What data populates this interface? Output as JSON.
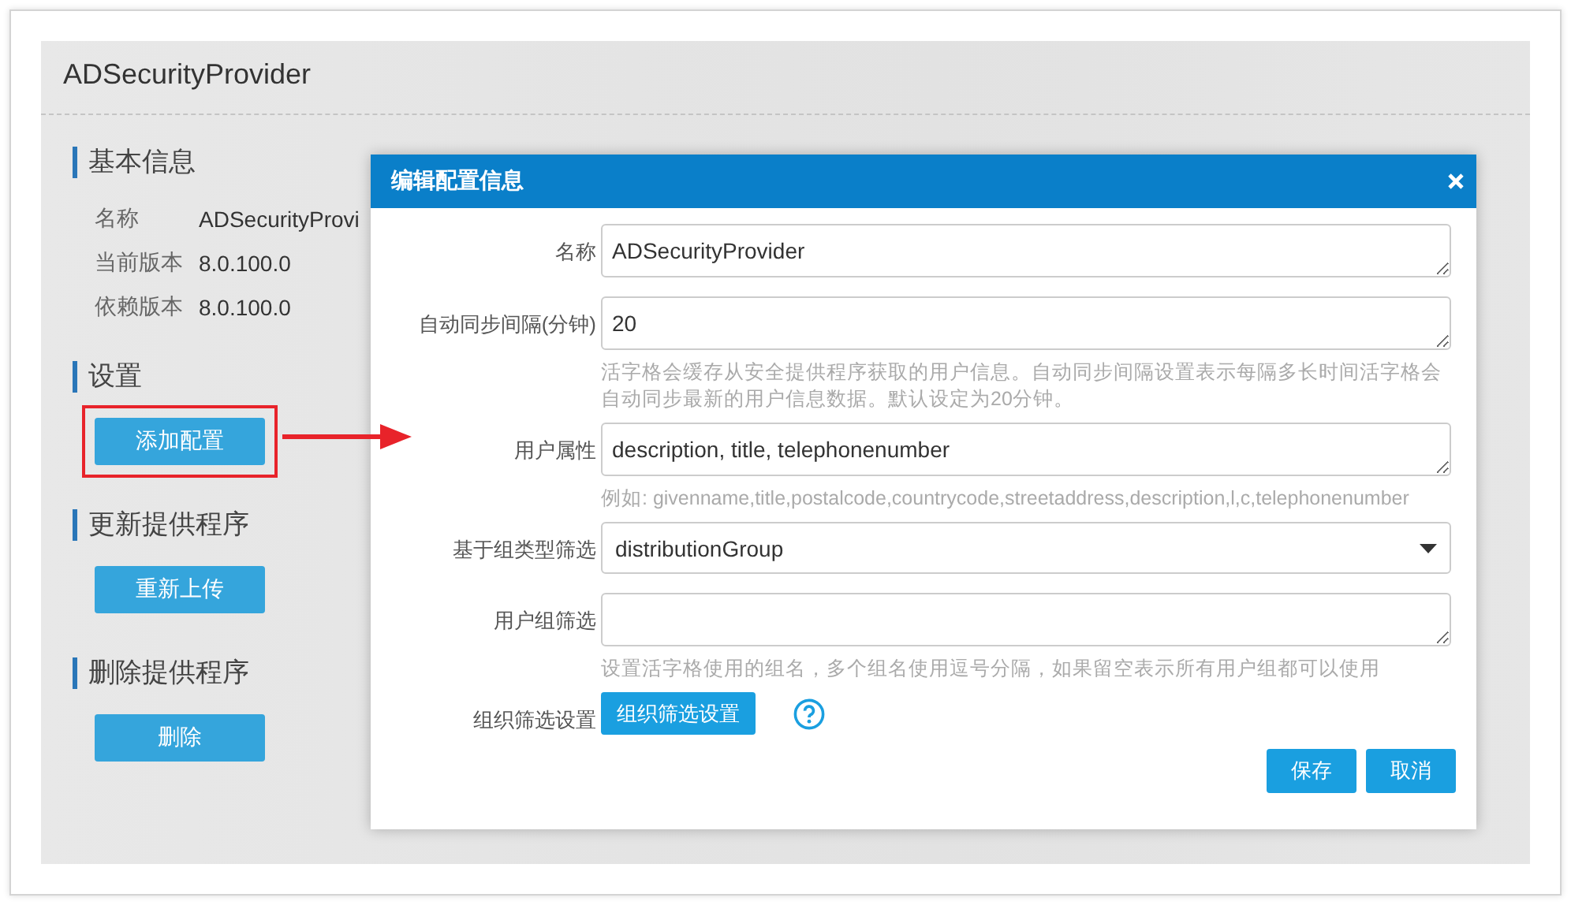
{
  "page": {
    "title": "ADSecurityProvider"
  },
  "sections": [
    {
      "heading": "基本信息",
      "kind": "info",
      "rows": [
        {
          "label": "名称",
          "value": "ADSecurityProvi"
        },
        {
          "label": "当前版本",
          "value": "8.0.100.0"
        },
        {
          "label": "依赖版本",
          "value": "8.0.100.0"
        }
      ]
    },
    {
      "heading": "设置",
      "kind": "button",
      "button": "添加配置",
      "highlighted": true
    },
    {
      "heading": "更新提供程序",
      "kind": "button",
      "button": "重新上传",
      "highlighted": false
    },
    {
      "heading": "删除提供程序",
      "kind": "button",
      "button": "删除",
      "highlighted": false
    }
  ],
  "dialog": {
    "title": "编辑配置信息",
    "fields": [
      {
        "label": "名称",
        "kind": "text",
        "value": "ADSecurityProvider"
      },
      {
        "label": "自动同步间隔(分钟)",
        "kind": "text",
        "value": "20",
        "hint": "活字格会缓存从安全提供程序获取的用户信息。自动同步间隔设置表示每隔多长时间活字格会自动同步最新的用户信息数据。默认设定为20分钟。"
      },
      {
        "label": "用户属性",
        "kind": "text",
        "value": "description, title, telephonenumber",
        "hint": "例如: givenname,title,postalcode,countrycode,streetaddress,description,l,c,telephonenumber"
      },
      {
        "label": "基于组类型筛选",
        "kind": "select",
        "value": "distributionGroup"
      },
      {
        "label": "用户组筛选",
        "kind": "text",
        "hint": "设置活字格使用的组名，多个组名使用逗号分隔，如果留空表示所有用户组都可以使用"
      },
      {
        "label": "组织筛选设置",
        "kind": "button",
        "button": "组织筛选设置"
      }
    ],
    "buttons": [
      "保存",
      "取消"
    ]
  }
}
